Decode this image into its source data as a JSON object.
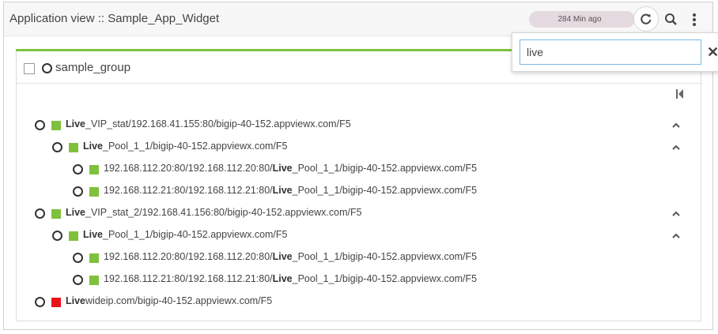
{
  "header": {
    "title": "Application view :: Sample_App_Widget",
    "last_refreshed": "284 Min ago"
  },
  "search": {
    "value": "live"
  },
  "group": {
    "label": "sample_group"
  },
  "tree": [
    {
      "level": 0,
      "status": "#7fc13d",
      "highlight": "Live",
      "rest": "_VIP_stat/192.168.41.155:80/bigip-40-152.appviewx.com/F5",
      "expanded": true
    },
    {
      "level": 1,
      "status": "#7fc13d",
      "highlight": "Live",
      "rest": "_Pool_1_1/bigip-40-152.appviewx.com/F5",
      "expanded": true
    },
    {
      "level": 2,
      "status": "#7fc13d",
      "prefix": "192.168.112.20:80/192.168.112.20:80/",
      "highlight": "Live",
      "rest": "_Pool_1_1/bigip-40-152.appviewx.com/F5"
    },
    {
      "level": 2,
      "status": "#7fc13d",
      "prefix": "192.168.112.21:80/192.168.112.21:80/",
      "highlight": "Live",
      "rest": "_Pool_1_1/bigip-40-152.appviewx.com/F5"
    },
    {
      "level": 0,
      "status": "#7fc13d",
      "highlight": "Live",
      "rest": "_VIP_stat_2/192.168.41.156:80/bigip-40-152.appviewx.com/F5",
      "expanded": true
    },
    {
      "level": 1,
      "status": "#7fc13d",
      "highlight": "Live",
      "rest": "_Pool_1_1/bigip-40-152.appviewx.com/F5",
      "expanded": true
    },
    {
      "level": 2,
      "status": "#7fc13d",
      "prefix": "192.168.112.20:80/192.168.112.20:80/",
      "highlight": "Live",
      "rest": "_Pool_1_1/bigip-40-152.appviewx.com/F5"
    },
    {
      "level": 2,
      "status": "#7fc13d",
      "prefix": "192.168.112.21:80/192.168.112.21:80/",
      "highlight": "Live",
      "rest": "_Pool_1_1/bigip-40-152.appviewx.com/F5"
    },
    {
      "level": 0,
      "status": "#e8141a",
      "highlight": "Live",
      "rest": "wideip.com/bigip-40-152.appviewx.com/F5"
    }
  ],
  "icons": {
    "refresh": "refresh-icon",
    "search": "search-icon",
    "more": "more-vertical-icon",
    "close": "close-icon",
    "collapse": "collapse-left-icon",
    "chevron": "chevron-up-icon"
  },
  "colors": {
    "accent": "#7fc13d",
    "status_ok": "#7fc13d",
    "status_error": "#e8141a"
  }
}
